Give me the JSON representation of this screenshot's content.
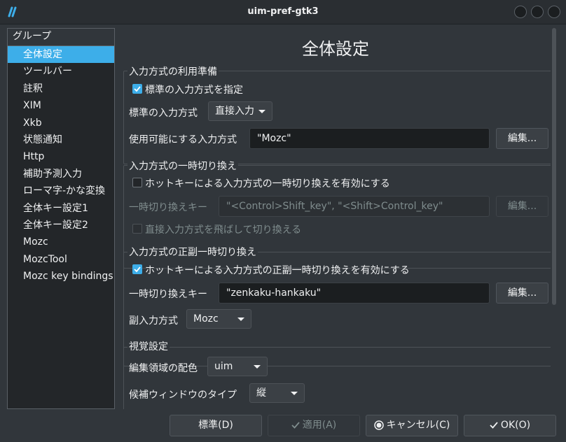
{
  "window": {
    "title": "uim-pref-gtk3"
  },
  "sidebar": {
    "header": "グループ",
    "items": [
      {
        "label": "全体設定"
      },
      {
        "label": "ツールバー"
      },
      {
        "label": "註釈"
      },
      {
        "label": "XIM"
      },
      {
        "label": "Xkb"
      },
      {
        "label": "状態通知"
      },
      {
        "label": "Http"
      },
      {
        "label": "補助予測入力"
      },
      {
        "label": "ローマ字-かな変換"
      },
      {
        "label": "全体キー設定1"
      },
      {
        "label": "全体キー設定2"
      },
      {
        "label": "Mozc"
      },
      {
        "label": "MozcTool"
      },
      {
        "label": "Mozc key bindings"
      }
    ]
  },
  "main": {
    "title": "全体設定",
    "im_setup": {
      "title": "入力方式の利用準備",
      "specify_default_label": "標準の入力方式を指定",
      "default_im_label": "標準の入力方式",
      "default_im_value": "直接入力",
      "enabled_ims_label": "使用可能にする入力方式",
      "enabled_ims_value": "\"Mozc\"",
      "edit_label": "編集..."
    },
    "im_switch": {
      "title": "入力方式の一時切り換え",
      "enable_label": "ホットキーによる入力方式の一時切り換えを有効にする",
      "key_label": "一時切り換えキー",
      "key_value": "\"<Control>Shift_key\", \"<Shift>Control_key\"",
      "edit_label": "編集...",
      "skip_direct_label": "直接入力方式を飛ばして切り換える"
    },
    "im_toggle": {
      "title": "入力方式の正副一時切り換え",
      "enable_label": "ホットキーによる入力方式の正副一時切り換えを有効にする",
      "key_label": "一時切り換えキー",
      "key_value": "\"zenkaku-hankaku\"",
      "edit_label": "編集...",
      "secondary_label": "副入力方式",
      "secondary_value": "Mozc"
    },
    "visual": {
      "title": "視覚設定",
      "preedit_color_label": "編集領域の配色",
      "preedit_color_value": "uim",
      "candwin_type_label": "候補ウィンドウのタイプ",
      "candwin_type_value": "縦"
    }
  },
  "footer": {
    "defaults_label": "標準(D)",
    "apply_label": "適用(A)",
    "cancel_label": "キャンセル(C)",
    "ok_label": "OK(O)"
  },
  "colors": {
    "accent": "#3daee9",
    "background": "#31363b",
    "field": "#1b1e20"
  }
}
